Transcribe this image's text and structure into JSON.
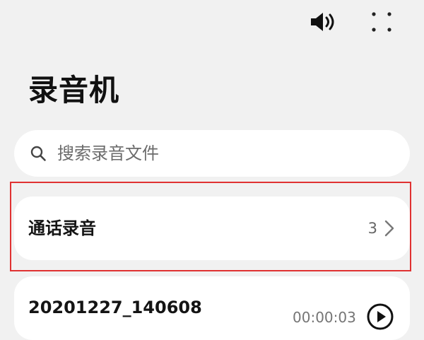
{
  "app": {
    "title": "录音机"
  },
  "top_bar": {
    "speaker_icon": "speaker-volume-icon",
    "more_icon": "more-dots-icon"
  },
  "search": {
    "placeholder": "搜索录音文件",
    "icon": "search-icon"
  },
  "call_recordings": {
    "label": "通话录音",
    "count": "3",
    "icon": "chevron-right-icon"
  },
  "recordings": [
    {
      "name": "20201227_140608",
      "duration": "00:00:03",
      "icon": "play-icon"
    }
  ],
  "colors": {
    "background": "#f1f1f1",
    "card": "#ffffff",
    "highlight_border": "#e03232",
    "text_primary": "#141414",
    "text_secondary": "#666666"
  }
}
